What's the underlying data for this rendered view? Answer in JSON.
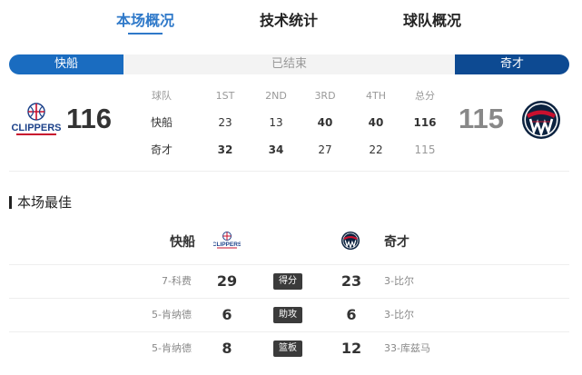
{
  "tabs": [
    "本场概况",
    "技术统计",
    "球队概况"
  ],
  "status": {
    "home_team": "快船",
    "away_team": "奇才",
    "game_status": "已结束"
  },
  "scores": {
    "home": "116",
    "away": "115"
  },
  "logos": {
    "home_logo_text": "CLIPPERS"
  },
  "quarters": {
    "headers": [
      "球队",
      "1ST",
      "2ND",
      "3RD",
      "4TH",
      "总分"
    ],
    "rows": [
      {
        "team": "快船",
        "q1": "23",
        "q2": "13",
        "q3": "40",
        "q4": "40",
        "total": "116"
      },
      {
        "team": "奇才",
        "q1": "32",
        "q2": "34",
        "q3": "27",
        "q4": "22",
        "total": "115"
      }
    ]
  },
  "best": {
    "title": "本场最佳",
    "home_team": "快船",
    "away_team": "奇才",
    "rows": [
      {
        "home_player": "7-科费",
        "home_value": "29",
        "category": "得分",
        "away_value": "23",
        "away_player": "3-比尔"
      },
      {
        "home_player": "5-肯纳德",
        "home_value": "6",
        "category": "助攻",
        "away_value": "6",
        "away_player": "3-比尔"
      },
      {
        "home_player": "5-肯纳德",
        "home_value": "8",
        "category": "篮板",
        "away_value": "12",
        "away_player": "33-库兹马"
      }
    ]
  },
  "colors": {
    "accent": "#2f79c9",
    "home_primary": "#1a6cc0",
    "away_primary": "#0d4a92",
    "clippers_red": "#c8102e",
    "wizards_red": "#c8102e"
  }
}
